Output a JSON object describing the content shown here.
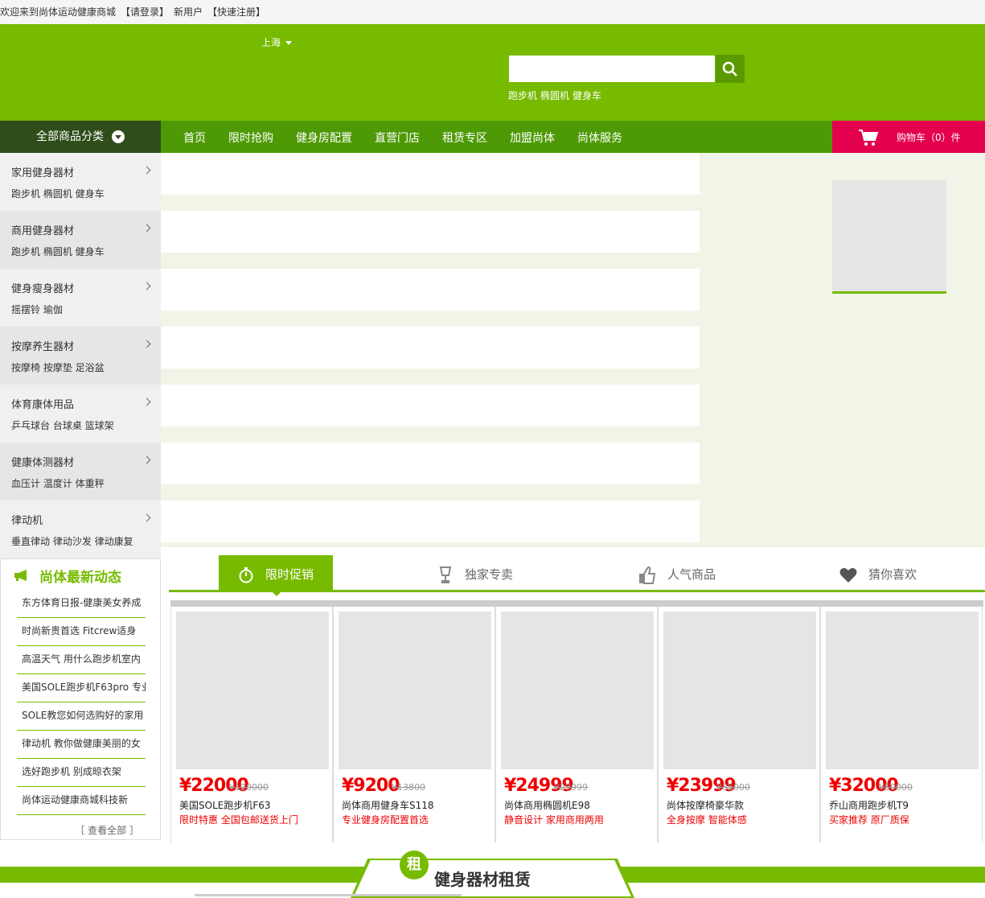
{
  "topbar": {
    "welcome": "欢迎来到尚体运动健康商城",
    "login": "【请登录】",
    "newuser": "新用户",
    "register": "【快速注册】"
  },
  "header": {
    "city": "上海",
    "search_placeholder": "",
    "hotwords": [
      "跑步机",
      "椭圆机",
      "健身车"
    ]
  },
  "nav": {
    "all_categories": "全部商品分类",
    "links": [
      "首页",
      "限时抢购",
      "健身房配置",
      "直营门店",
      "租赁专区",
      "加盟尚体",
      "尚体服务"
    ],
    "cart": "购物车（0）件"
  },
  "categories": [
    {
      "title": "家用健身器材",
      "subs": "跑步机 椭圆机 健身车"
    },
    {
      "title": "商用健身器材",
      "subs": "跑步机 椭圆机 健身车"
    },
    {
      "title": "健身瘦身器材",
      "subs": "摇摆铃 瑜伽"
    },
    {
      "title": "按摩养生器材",
      "subs": "按摩椅 按摩垫 足浴盆"
    },
    {
      "title": "体育康体用品",
      "subs": "乒乓球台 台球桌 篮球架"
    },
    {
      "title": "健康体测器材",
      "subs": "血压计 温度计 体重秤"
    },
    {
      "title": "律动机",
      "subs": "垂直律动 律动沙发 律动康复"
    }
  ],
  "news": {
    "title": "尚体最新动态",
    "items": [
      "东方体育日报-健康美女养成",
      "时尚新贵首选 Fitcrew适身",
      "高温天气 用什么跑步机室内",
      "美国SOLE跑步机F63pro 专业",
      "SOLE教您如何选购好的家用",
      "律动机 教你做健康美丽的女",
      "选好跑步机 别成晾衣架",
      "尚体运动健康商城科技新"
    ],
    "more": "［ 查看全部 ］"
  },
  "tabs": [
    "限时促销",
    "独家专卖",
    "人气商品",
    "猜你喜欢"
  ],
  "products": [
    {
      "price": "¥22000",
      "old": "¥120000",
      "name": "美国SOLE跑步机F63",
      "desc": "限时特惠 全国包邮送货上门"
    },
    {
      "price": "¥9200",
      "old": "¥13800",
      "name": "尚体商用健身车S118",
      "desc": "专业健身房配置首选"
    },
    {
      "price": "¥24999",
      "old": "¥29999",
      "name": "尚体商用椭圆机E98",
      "desc": "静音设计 家用商用两用"
    },
    {
      "price": "¥23999",
      "old": "¥35000",
      "name": "尚体按摩椅豪华款",
      "desc": "全身按摩 智能体感"
    },
    {
      "price": "¥32000",
      "old": "¥50000",
      "name": "乔山商用跑步机T9",
      "desc": "买家推荐 原厂质保"
    }
  ],
  "rental": {
    "badge": "租",
    "title": "健身器材租赁"
  },
  "colors": {
    "brand": "#77bb00",
    "nav": "#4e9a06",
    "cart": "#e3004e",
    "price": "#ee0000"
  }
}
